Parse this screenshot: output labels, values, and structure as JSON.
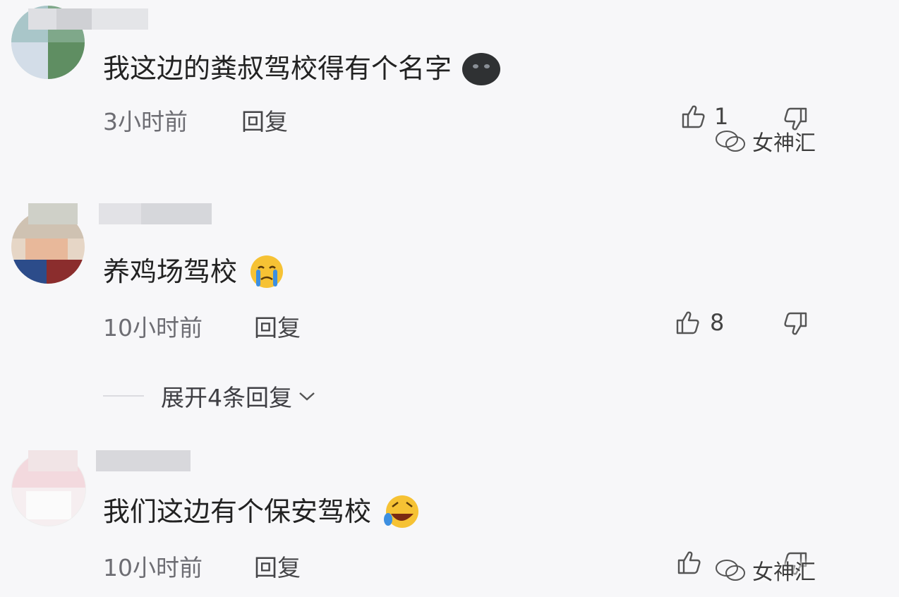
{
  "comments": [
    {
      "text": "我这边的粪叔驾校得有个名字",
      "emoji": "dark-face-emoji",
      "time": "3小时前",
      "reply_label": "回复",
      "likes": "1"
    },
    {
      "text": "养鸡场驾校",
      "emoji": "crying-face-emoji",
      "time": "10小时前",
      "reply_label": "回复",
      "likes": "8"
    },
    {
      "text": "我们这边有个保安驾校",
      "emoji": "rolling-laughing-emoji",
      "time": "10小时前",
      "reply_label": "回复",
      "likes": ""
    }
  ],
  "expand_replies": {
    "label": "展开4条回复"
  },
  "watermark": {
    "text": "女神汇"
  },
  "colors": {
    "background": "#f7f7f9",
    "text_primary": "#222222",
    "text_secondary": "#6d6d73",
    "emoji_yellow": "#f6c234",
    "emoji_blue": "#3d8fe0"
  }
}
